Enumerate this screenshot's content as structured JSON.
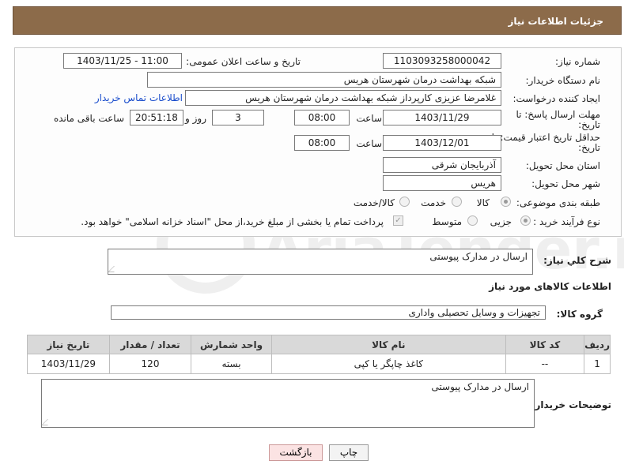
{
  "header": {
    "title": "جزئیات اطلاعات نیاز"
  },
  "fields": {
    "need_number_label": "شماره نیاز:",
    "need_number": "1103093258000042",
    "announce_label": "تاریخ و ساعت اعلان عمومی:",
    "announce_value": "1403/11/25 - 11:00",
    "buyer_org_label": "نام دستگاه خریدار:",
    "buyer_org": "شبکه بهداشت درمان شهرستان هریس",
    "creator_label": "ایجاد کننده درخواست:",
    "creator": "غلامرضا عزیزی کارپرداز شبکه بهداشت درمان شهرستان هریس",
    "contact_link": "اطلاعات تماس خریدار",
    "deadline_label_1": "مهلت ارسال پاسخ: تا",
    "deadline_label_2": "تاریخ:",
    "deadline_date": "1403/11/29",
    "time_label": "ساعت",
    "deadline_time": "08:00",
    "days_value": "3",
    "days_label": "روز و",
    "remaining_time": "20:51:18",
    "remaining_label": "ساعت باقی مانده",
    "validity_label_1": "حداقل تاریخ اعتبار قیمت: تا",
    "validity_label_2": "تاریخ:",
    "validity_date": "1403/12/01",
    "validity_time": "08:00",
    "province_label": "استان محل تحویل:",
    "province": "آذربایجان شرقی",
    "city_label": "شهر محل تحویل:",
    "city": "هریس",
    "category_label": "طبقه بندی موضوعی:",
    "category_options": [
      "کالا",
      "خدمت",
      "کالا/خدمت"
    ],
    "process_label": "نوع فرآیند خرید :",
    "process_options": [
      "جزیی",
      "متوسط"
    ],
    "payment_note": "پرداخت تمام یا بخشی از مبلغ خرید،از محل \"اسناد خزانه اسلامی\" خواهد بود."
  },
  "summary": {
    "label": "شرح کلي نياز:",
    "value": "ارسال در مدارک پیوستی",
    "goods_info_title": "اطلاعات کالاهای مورد نیاز",
    "group_label": "گروه کالا:",
    "group_value": "تجهیزات و وسایل تحصیلی واداری"
  },
  "table": {
    "headers": [
      "ردیف",
      "کد کالا",
      "نام کالا",
      "واحد شمارش",
      "تعداد / مقدار",
      "تاریخ نیاز"
    ],
    "rows": [
      [
        "1",
        "--",
        "کاغذ چاپگر یا کپی",
        "بسته",
        "120",
        "1403/11/29"
      ]
    ]
  },
  "buyer_notes": {
    "label": "توضیحات خریدار:",
    "value": "ارسال در مدارک پیوستی"
  },
  "buttons": {
    "print": "چاپ",
    "back": "بازگشت"
  },
  "watermark_text": "AriaTender.net"
}
